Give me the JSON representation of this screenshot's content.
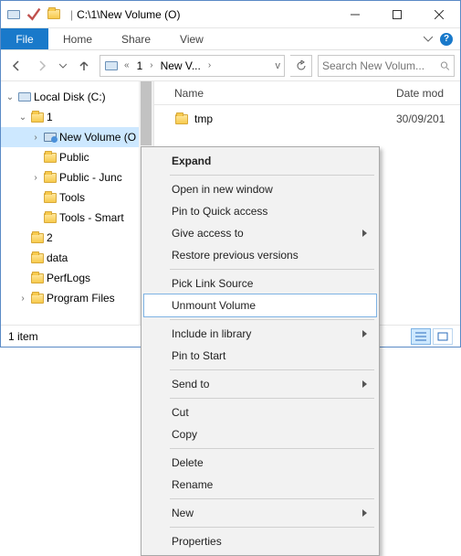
{
  "titlebar": {
    "title": "C:\\1\\New Volume (O)"
  },
  "ribbon": {
    "file": "File",
    "tabs": [
      "Home",
      "Share",
      "View"
    ]
  },
  "address": {
    "crumbs": [
      "1",
      "New V..."
    ],
    "dropdown_indicator": "v"
  },
  "search": {
    "placeholder": "Search New Volum..."
  },
  "tree": [
    {
      "indent": 0,
      "exp": "open",
      "icon": "drive",
      "label": "Local Disk (C:)"
    },
    {
      "indent": 1,
      "exp": "open",
      "icon": "folder",
      "label": "1"
    },
    {
      "indent": 2,
      "exp": "closed",
      "icon": "vhd",
      "label": "New Volume (O",
      "selected": true
    },
    {
      "indent": 2,
      "exp": "none",
      "icon": "folder",
      "label": "Public"
    },
    {
      "indent": 2,
      "exp": "closed",
      "icon": "folder",
      "label": "Public - Junc"
    },
    {
      "indent": 2,
      "exp": "none",
      "icon": "folder",
      "label": "Tools"
    },
    {
      "indent": 2,
      "exp": "none",
      "icon": "folder",
      "label": "Tools - Smart"
    },
    {
      "indent": 1,
      "exp": "none",
      "icon": "folder",
      "label": "2"
    },
    {
      "indent": 1,
      "exp": "none",
      "icon": "folder",
      "label": "data"
    },
    {
      "indent": 1,
      "exp": "none",
      "icon": "folder",
      "label": "PerfLogs"
    },
    {
      "indent": 1,
      "exp": "closed",
      "icon": "folder",
      "label": "Program Files"
    }
  ],
  "columns": {
    "name": "Name",
    "date": "Date mod"
  },
  "rows": [
    {
      "name": "tmp",
      "date": "30/09/201"
    }
  ],
  "status": {
    "text": "1 item"
  },
  "ctx": [
    {
      "type": "item",
      "label": "Expand",
      "bold": true
    },
    {
      "type": "sep"
    },
    {
      "type": "item",
      "label": "Open in new window"
    },
    {
      "type": "item",
      "label": "Pin to Quick access"
    },
    {
      "type": "item",
      "label": "Give access to",
      "sub": true
    },
    {
      "type": "item",
      "label": "Restore previous versions"
    },
    {
      "type": "sep"
    },
    {
      "type": "item",
      "label": "Pick Link Source"
    },
    {
      "type": "item",
      "label": "Unmount Volume",
      "hover": true
    },
    {
      "type": "sep"
    },
    {
      "type": "item",
      "label": "Include in library",
      "sub": true
    },
    {
      "type": "item",
      "label": "Pin to Start"
    },
    {
      "type": "sep"
    },
    {
      "type": "item",
      "label": "Send to",
      "sub": true
    },
    {
      "type": "sep"
    },
    {
      "type": "item",
      "label": "Cut"
    },
    {
      "type": "item",
      "label": "Copy"
    },
    {
      "type": "sep"
    },
    {
      "type": "item",
      "label": "Delete"
    },
    {
      "type": "item",
      "label": "Rename"
    },
    {
      "type": "sep"
    },
    {
      "type": "item",
      "label": "New",
      "sub": true
    },
    {
      "type": "sep"
    },
    {
      "type": "item",
      "label": "Properties"
    }
  ]
}
